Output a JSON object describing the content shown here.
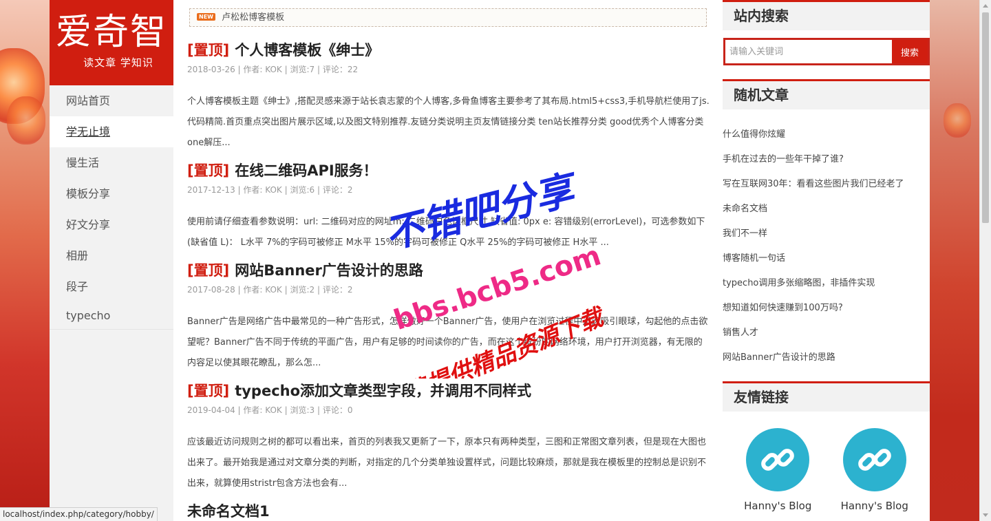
{
  "site": {
    "logo_title": "爱奇智",
    "logo_subtitle": "读文章 学知识"
  },
  "nav": {
    "items": [
      {
        "label": "网站首页"
      },
      {
        "label": "学无止境"
      },
      {
        "label": "慢生活"
      },
      {
        "label": "模板分享"
      },
      {
        "label": "好文分享"
      },
      {
        "label": "相册"
      },
      {
        "label": "段子"
      },
      {
        "label": "typecho"
      }
    ],
    "active_index": 1
  },
  "notice": {
    "badge": "NEW",
    "text": "卢松松博客模板"
  },
  "posts": [
    {
      "tag": "[置顶]",
      "title": "个人博客模板《绅士》",
      "meta": "2018-03-26 | 作者: KOK | 浏览:7 | 评论：22",
      "excerpt": "个人博客模板主题《绅士》,搭配灵感来源于站长袁志蒙的个人博客,多骨鱼博客主要参考了其布局.html5+css3,手机导航栏使用了js.代码精简.首页重点突出图片展示区域,以及图文特别推荐.友链分类说明主页友情链接分类 ten站长推荐分类 good优秀个人博客分类 one解压..."
    },
    {
      "tag": "[置顶]",
      "title": "在线二维码API服务！",
      "meta": "2017-12-13 | 作者: KOK | 浏览:6 | 评论：2",
      "excerpt": "使用前请仔细查看参数说明：url: 二维码对应的网址m: 二维码白色边框尺寸,缺省值: 0px e: 容错级别(errorLevel)，可选参数如下(缺省值 L)： L水平 7%的字码可被修正 M水平 15%的字码可被修正 Q水平 25%的字码可被修正 H水平 ..."
    },
    {
      "tag": "[置顶]",
      "title": "网站Banner广告设计的思路",
      "meta": "2017-08-28 | 作者: KOK | 浏览:2 | 评论：2",
      "excerpt": "Banner广告是网络广告中最常见的一种广告形式，怎样做好一个Banner广告，使用户在浏览过程中迅速吸引眼球，勾起他的点击欲望呢？Banner广告不同于传统的平面广告，用户有足够的时间读你的广告，而在这个缤纷的网络环境，用户打开浏览器，有无限的内容足以使其眼花瞭乱，那么怎..."
    },
    {
      "tag": "[置顶]",
      "title": "typecho添加文章类型字段，并调用不同样式",
      "meta": "2019-04-04 | 作者: KOK | 浏览:3 | 评论：0",
      "excerpt": "应该最近访问规则之树的都可以看出来，首页的列表我又更新了一下，原本只有两种类型，三图和正常图文章列表，但是现在大图也出来了。最开始我是通过对文章分类的判断，对指定的几个分类单独设置样式，问题比较麻烦，那就是我在模板里的控制总是识别不出来，就算使用stristr包含方法也会有..."
    },
    {
      "tag": "",
      "title": "未命名文档1",
      "meta": "",
      "excerpt": ""
    }
  ],
  "search": {
    "heading": "站内搜索",
    "placeholder": "请输入关键词",
    "button": "搜索"
  },
  "random": {
    "heading": "随机文章",
    "items": [
      "什么值得你炫耀",
      "手机在过去的一些年干掉了谁?",
      "写在互联网30年：看看这些图片我们已经老了",
      "未命名文档",
      "我们不一样",
      "博客随机一句话",
      "typecho调用多张缩略图，非插件实现",
      "想知道如何快速赚到100万吗?",
      "销售人才",
      "网站Banner广告设计的思路"
    ]
  },
  "links": {
    "heading": "友情链接",
    "items": [
      {
        "name": "Hanny's Blog",
        "icon": "link-icon"
      },
      {
        "name": "Hanny's Blog",
        "icon": "link-icon"
      }
    ]
  },
  "watermark": {
    "line1": "不错吧分享",
    "line2": "bbs.bcb5.com",
    "line3": "免费提供精品资源下载"
  },
  "statusbar": {
    "url": "localhost/index.php/category/hobby/"
  },
  "colors": {
    "brand_red": "#d01e10",
    "link_teal": "#2cb2cf",
    "watermark_blue": "#1a2be0",
    "watermark_pink": "#ee2a86",
    "watermark_red": "#e01010"
  }
}
